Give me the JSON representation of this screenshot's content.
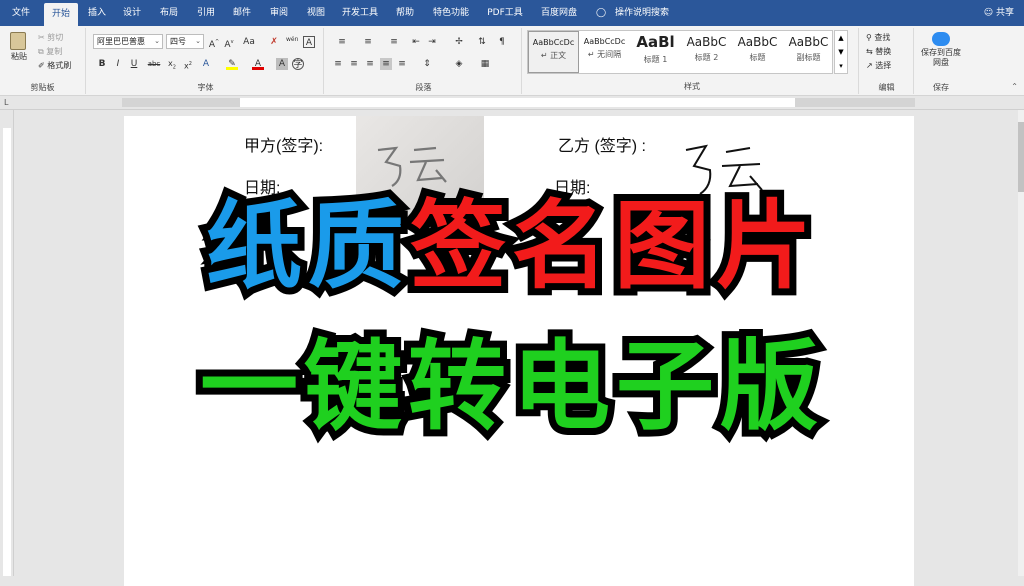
{
  "tabs": [
    "文件",
    "开始",
    "插入",
    "设计",
    "布局",
    "引用",
    "邮件",
    "审阅",
    "视图",
    "开发工具",
    "帮助",
    "特色功能",
    "PDF工具",
    "百度网盘"
  ],
  "active_tab": "开始",
  "tell_me": "操作说明搜索",
  "share": "共享",
  "clipboard": {
    "paste": "粘贴",
    "cut": "剪切",
    "copy": "复制",
    "format_painter": "格式刷",
    "label": "剪贴板"
  },
  "font": {
    "name": "阿里巴巴普惠",
    "size": "四号",
    "label": "字体"
  },
  "paragraph": {
    "label": "段落"
  },
  "styles": {
    "label": "样式",
    "items": [
      {
        "preview": "AaBbCcDc",
        "name": "↵ 正文"
      },
      {
        "preview": "AaBbCcDc",
        "name": "↵ 无间隔"
      },
      {
        "preview": "AaBl",
        "name": "标题 1"
      },
      {
        "preview": "AaBbC",
        "name": "标题 2"
      },
      {
        "preview": "AaBbC",
        "name": "标题"
      },
      {
        "preview": "AaBbC",
        "name": "副标题"
      }
    ]
  },
  "editing": {
    "find": "查找",
    "replace": "替换",
    "select": "选择",
    "label": "编辑"
  },
  "save": {
    "button": "保存到百度网盘",
    "label": "保存"
  },
  "document": {
    "party_a": "甲方(签字):",
    "party_b": "乙方  (签字)  :",
    "date_a": "日期:",
    "date_b": "日期:",
    "signature_text": "马云"
  },
  "overlay": {
    "line1_blue": "纸质",
    "line1_red": "签名图片",
    "line2_green": "一键转电子版"
  },
  "colors": {
    "blue": "#1a9bea",
    "red": "#f21b1b",
    "green": "#1fd01f",
    "ribbon": "#2b579a"
  }
}
